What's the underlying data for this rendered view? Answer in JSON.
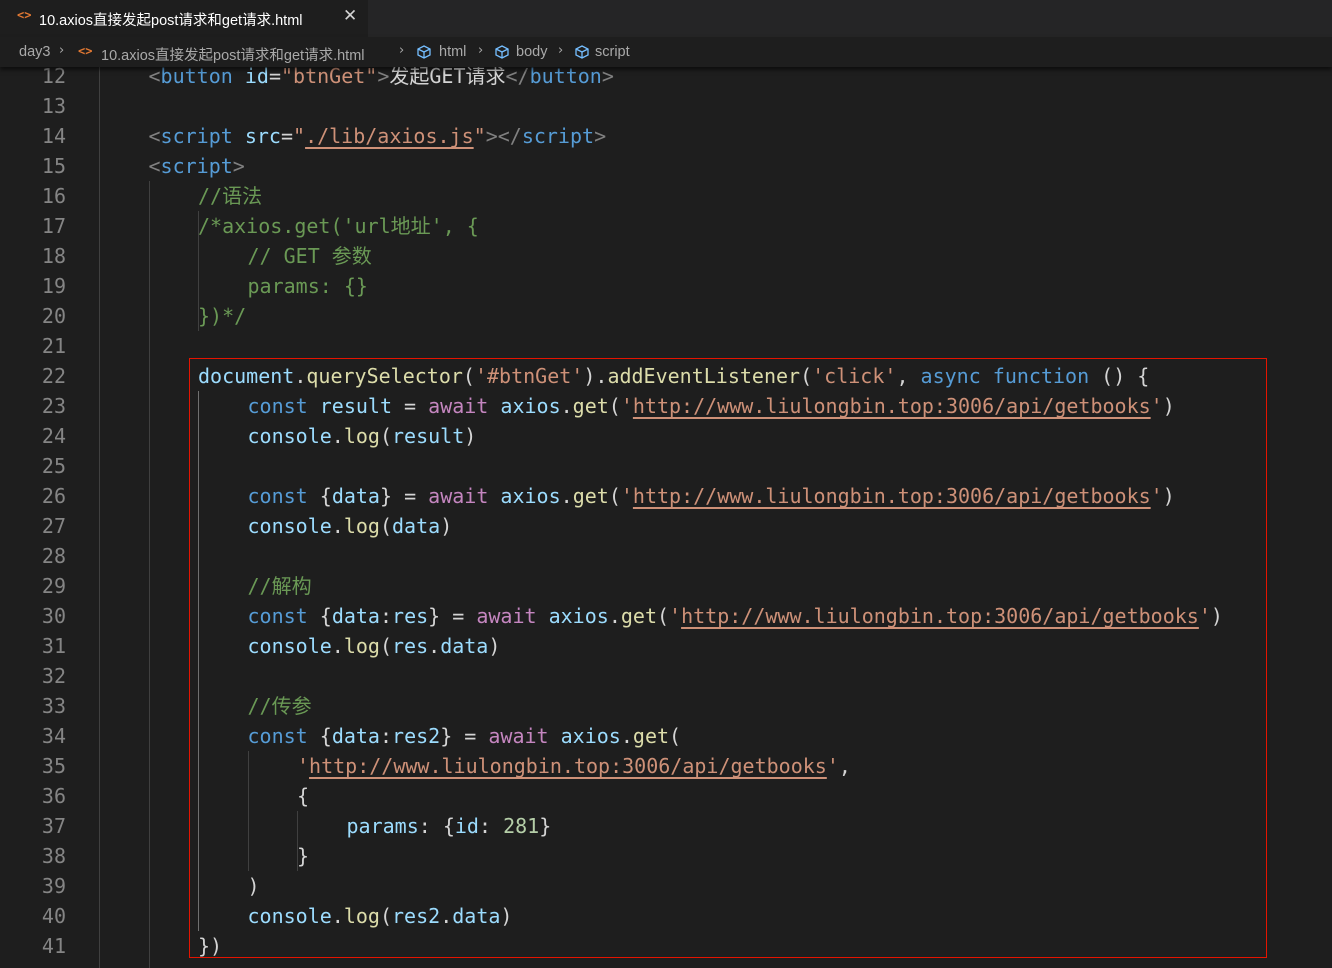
{
  "tab": {
    "title": "10.axios直接发起post请求和get请求.html",
    "icon": "html-file-icon",
    "close_glyph": "✕"
  },
  "breadcrumb": {
    "folder": "day3",
    "file": "10.axios直接发起post请求和get请求.html",
    "nodes": [
      "html",
      "body",
      "script"
    ]
  },
  "colors": {
    "background": "#1e1e1e",
    "highlight_border": "#e51400",
    "keyword": "#569cd6",
    "string": "#ce9178",
    "comment": "#6a9955",
    "function": "#dcdcaa",
    "variable": "#9cdcfe",
    "control": "#c586c0",
    "number": "#b5cea8"
  },
  "editor": {
    "lines": [
      {
        "n": "12",
        "indent": 1,
        "tokens": [
          [
            "tag",
            "<"
          ],
          [
            "tagname",
            "button"
          ],
          [
            "plain",
            " "
          ],
          [
            "attr",
            "id"
          ],
          [
            "plain",
            "="
          ],
          [
            "str",
            "\"btnGet\""
          ],
          [
            "tag",
            ">"
          ],
          [
            "text",
            "发起GET请求"
          ],
          [
            "tag",
            "</"
          ],
          [
            "tagname",
            "button"
          ],
          [
            "tag",
            ">"
          ]
        ]
      },
      {
        "n": "13",
        "indent": 0,
        "tokens": []
      },
      {
        "n": "14",
        "indent": 1,
        "tokens": [
          [
            "tag",
            "<"
          ],
          [
            "tagname",
            "script"
          ],
          [
            "plain",
            " "
          ],
          [
            "attr",
            "src"
          ],
          [
            "plain",
            "="
          ],
          [
            "str",
            "\""
          ],
          [
            "link",
            "./lib/axios.js"
          ],
          [
            "str",
            "\""
          ],
          [
            "tag",
            "></"
          ],
          [
            "tagname",
            "script"
          ],
          [
            "tag",
            ">"
          ]
        ]
      },
      {
        "n": "15",
        "indent": 1,
        "tokens": [
          [
            "tag",
            "<"
          ],
          [
            "tagname",
            "script"
          ],
          [
            "tag",
            ">"
          ]
        ]
      },
      {
        "n": "16",
        "indent": 2,
        "tokens": [
          [
            "cmt",
            "//语法"
          ]
        ]
      },
      {
        "n": "17",
        "indent": 2,
        "tokens": [
          [
            "cmt",
            "/*axios.get('url地址', {"
          ]
        ]
      },
      {
        "n": "18",
        "indent": 3,
        "tokens": [
          [
            "cmt",
            "// GET 参数"
          ]
        ]
      },
      {
        "n": "19",
        "indent": 3,
        "tokens": [
          [
            "cmt",
            "params: {}"
          ]
        ]
      },
      {
        "n": "20",
        "indent": 2,
        "tokens": [
          [
            "cmt",
            "})*/"
          ]
        ]
      },
      {
        "n": "21",
        "indent": 0,
        "tokens": []
      },
      {
        "n": "22",
        "indent": 2,
        "tokens": [
          [
            "var",
            "document"
          ],
          [
            "plain",
            "."
          ],
          [
            "fn",
            "querySelector"
          ],
          [
            "plain",
            "("
          ],
          [
            "str",
            "'#btnGet'"
          ],
          [
            "plain",
            ")."
          ],
          [
            "fn",
            "addEventListener"
          ],
          [
            "plain",
            "("
          ],
          [
            "str",
            "'click'"
          ],
          [
            "plain",
            ", "
          ],
          [
            "kw",
            "async"
          ],
          [
            "plain",
            " "
          ],
          [
            "kw",
            "function"
          ],
          [
            "plain",
            " () {"
          ]
        ]
      },
      {
        "n": "23",
        "indent": 3,
        "tokens": [
          [
            "kw",
            "const"
          ],
          [
            "plain",
            " "
          ],
          [
            "var",
            "result"
          ],
          [
            "plain",
            " = "
          ],
          [
            "ctrl",
            "await"
          ],
          [
            "plain",
            " "
          ],
          [
            "var",
            "axios"
          ],
          [
            "plain",
            "."
          ],
          [
            "fn",
            "get"
          ],
          [
            "plain",
            "("
          ],
          [
            "str",
            "'"
          ],
          [
            "link",
            "http://www.liulongbin.top:3006/api/getbooks"
          ],
          [
            "str",
            "'"
          ],
          [
            "plain",
            ")"
          ]
        ]
      },
      {
        "n": "24",
        "indent": 3,
        "tokens": [
          [
            "var",
            "console"
          ],
          [
            "plain",
            "."
          ],
          [
            "fn",
            "log"
          ],
          [
            "plain",
            "("
          ],
          [
            "var",
            "result"
          ],
          [
            "plain",
            ")"
          ]
        ]
      },
      {
        "n": "25",
        "indent": 0,
        "tokens": []
      },
      {
        "n": "26",
        "indent": 3,
        "tokens": [
          [
            "kw",
            "const"
          ],
          [
            "plain",
            " {"
          ],
          [
            "var",
            "data"
          ],
          [
            "plain",
            "} = "
          ],
          [
            "ctrl",
            "await"
          ],
          [
            "plain",
            " "
          ],
          [
            "var",
            "axios"
          ],
          [
            "plain",
            "."
          ],
          [
            "fn",
            "get"
          ],
          [
            "plain",
            "("
          ],
          [
            "str",
            "'"
          ],
          [
            "link",
            "http://www.liulongbin.top:3006/api/getbooks"
          ],
          [
            "str",
            "'"
          ],
          [
            "plain",
            ")"
          ]
        ]
      },
      {
        "n": "27",
        "indent": 3,
        "tokens": [
          [
            "var",
            "console"
          ],
          [
            "plain",
            "."
          ],
          [
            "fn",
            "log"
          ],
          [
            "plain",
            "("
          ],
          [
            "var",
            "data"
          ],
          [
            "plain",
            ")"
          ]
        ]
      },
      {
        "n": "28",
        "indent": 0,
        "tokens": []
      },
      {
        "n": "29",
        "indent": 3,
        "tokens": [
          [
            "cmt",
            "//解构"
          ]
        ]
      },
      {
        "n": "30",
        "indent": 3,
        "tokens": [
          [
            "kw",
            "const"
          ],
          [
            "plain",
            " {"
          ],
          [
            "var",
            "data"
          ],
          [
            "plain",
            ":"
          ],
          [
            "var",
            "res"
          ],
          [
            "plain",
            "} = "
          ],
          [
            "ctrl",
            "await"
          ],
          [
            "plain",
            " "
          ],
          [
            "var",
            "axios"
          ],
          [
            "plain",
            "."
          ],
          [
            "fn",
            "get"
          ],
          [
            "plain",
            "("
          ],
          [
            "str",
            "'"
          ],
          [
            "link",
            "http://www.liulongbin.top:3006/api/getbooks"
          ],
          [
            "str",
            "'"
          ],
          [
            "plain",
            ")"
          ]
        ]
      },
      {
        "n": "31",
        "indent": 3,
        "tokens": [
          [
            "var",
            "console"
          ],
          [
            "plain",
            "."
          ],
          [
            "fn",
            "log"
          ],
          [
            "plain",
            "("
          ],
          [
            "var",
            "res"
          ],
          [
            "plain",
            "."
          ],
          [
            "var",
            "data"
          ],
          [
            "plain",
            ")"
          ]
        ]
      },
      {
        "n": "32",
        "indent": 0,
        "tokens": []
      },
      {
        "n": "33",
        "indent": 3,
        "tokens": [
          [
            "cmt",
            "//传参"
          ]
        ]
      },
      {
        "n": "34",
        "indent": 3,
        "tokens": [
          [
            "kw",
            "const"
          ],
          [
            "plain",
            " {"
          ],
          [
            "var",
            "data"
          ],
          [
            "plain",
            ":"
          ],
          [
            "var",
            "res2"
          ],
          [
            "plain",
            "} = "
          ],
          [
            "ctrl",
            "await"
          ],
          [
            "plain",
            " "
          ],
          [
            "var",
            "axios"
          ],
          [
            "plain",
            "."
          ],
          [
            "fn",
            "get"
          ],
          [
            "plain",
            "("
          ]
        ]
      },
      {
        "n": "35",
        "indent": 4,
        "tokens": [
          [
            "str",
            "'"
          ],
          [
            "link",
            "http://www.liulongbin.top:3006/api/getbooks"
          ],
          [
            "str",
            "'"
          ],
          [
            "plain",
            ","
          ]
        ]
      },
      {
        "n": "36",
        "indent": 4,
        "tokens": [
          [
            "plain",
            "{"
          ]
        ]
      },
      {
        "n": "37",
        "indent": 5,
        "tokens": [
          [
            "var",
            "params"
          ],
          [
            "plain",
            ": {"
          ],
          [
            "var",
            "id"
          ],
          [
            "plain",
            ": "
          ],
          [
            "num",
            "281"
          ],
          [
            "plain",
            "}"
          ]
        ]
      },
      {
        "n": "38",
        "indent": 4,
        "tokens": [
          [
            "plain",
            "}"
          ]
        ]
      },
      {
        "n": "39",
        "indent": 3,
        "tokens": [
          [
            "plain",
            ")"
          ]
        ]
      },
      {
        "n": "40",
        "indent": 3,
        "tokens": [
          [
            "var",
            "console"
          ],
          [
            "plain",
            "."
          ],
          [
            "fn",
            "log"
          ],
          [
            "plain",
            "("
          ],
          [
            "var",
            "res2"
          ],
          [
            "plain",
            "."
          ],
          [
            "var",
            "data"
          ],
          [
            "plain",
            ")"
          ]
        ]
      },
      {
        "n": "41",
        "indent": 2,
        "tokens": [
          [
            "plain",
            "})"
          ]
        ]
      }
    ]
  }
}
